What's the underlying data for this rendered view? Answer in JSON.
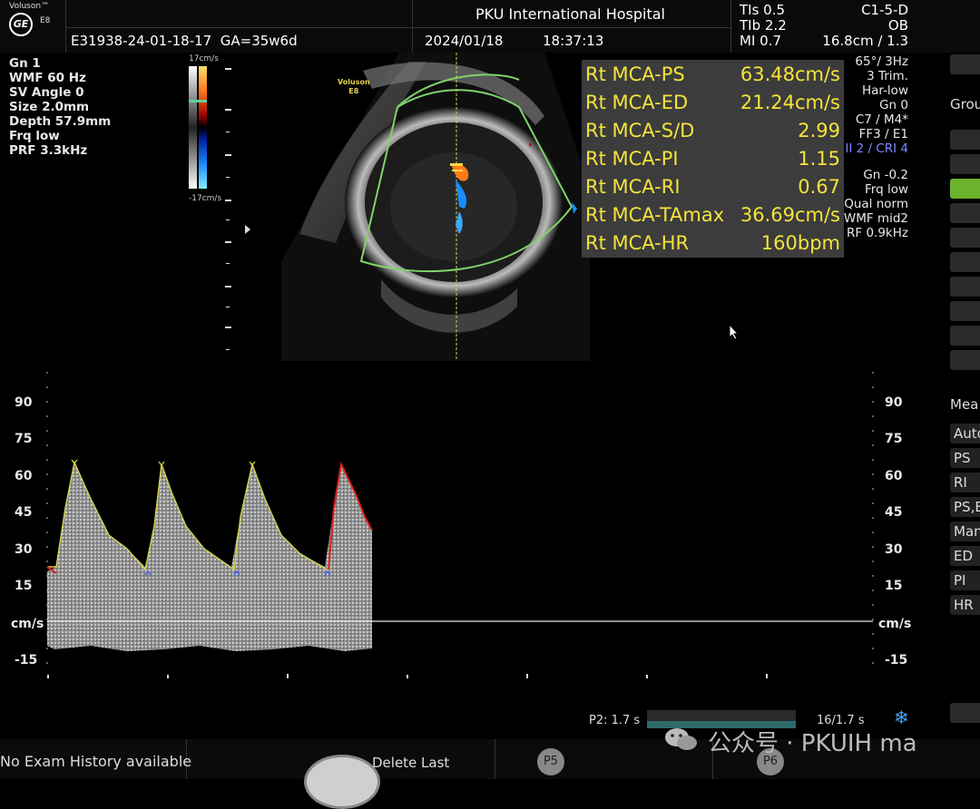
{
  "header": {
    "brand": "Voluson™",
    "logo": "GE",
    "model": "E8",
    "patient_id": "E31938-24-01-18-17",
    "ga": "GA=35w6d",
    "hospital": "PKU International Hospital",
    "date": "2024/01/18",
    "time": "18:37:13",
    "thermal": [
      "TIs  0.5",
      "TIb  2.2",
      "MI  0.7"
    ],
    "probe": [
      "C1-5-D",
      "OB",
      "16.8cm / 1.3"
    ]
  },
  "left_params": [
    "Gn  1",
    "WMF 60 Hz",
    "SV Angle  0",
    "Size  2.0mm",
    "Depth 57.9mm",
    "Frq low",
    "PRF  3.3kHz"
  ],
  "colorbar": {
    "top": "17cm/s",
    "bottom": "-17cm/s"
  },
  "image_logo": [
    "Voluson",
    "E8"
  ],
  "measurements": [
    {
      "label": "Rt MCA-PS",
      "value": "63.48cm/s"
    },
    {
      "label": "Rt MCA-ED",
      "value": "21.24cm/s"
    },
    {
      "label": "Rt MCA-S/D",
      "value": "2.99"
    },
    {
      "label": "Rt MCA-PI",
      "value": "1.15"
    },
    {
      "label": "Rt MCA-RI",
      "value": "0.67"
    },
    {
      "label": "Rt MCA-TAmax",
      "value": "36.69cm/s"
    },
    {
      "label": "Rt MCA-HR",
      "value": "160bpm"
    }
  ],
  "right_params_top": [
    "65°/  3Hz",
    "3 Trim.",
    "Har-low",
    "Gn  0",
    "C7 / M4*",
    "FF3 / E1",
    "II 2 / CRI 4"
  ],
  "right_params_bottom": [
    "Gn -0.2",
    "Frq low",
    "Qual norm",
    "WMF mid2",
    "RF  0.9kHz"
  ],
  "side_menu": {
    "group_label": "Grou",
    "meas_label": "Mea",
    "items": [
      "Auto",
      "PS",
      "RI",
      "PS,E",
      "Man",
      "ED",
      "PI",
      "HR"
    ]
  },
  "spectrum": {
    "ticks_left": [
      "90",
      "75",
      "60",
      "45",
      "30",
      "15",
      "cm/s",
      "-15"
    ],
    "ticks_right": [
      "90",
      "75",
      "60",
      "45",
      "30",
      "15",
      "cm/s",
      "-15"
    ]
  },
  "cine": {
    "p2_label": "P2:  1.7 s",
    "counter": "16/1.7 s",
    "progress": 1.0
  },
  "bottom": {
    "no_history": "No Exam History available",
    "delete_last": "Delete Last",
    "p5": "P5",
    "p6": "P6",
    "watermark": "公众号 · PKUIH ma"
  },
  "colors": {
    "measurement": "#f5e33a",
    "trace": "#d6d24a",
    "sector": "#7fd26a",
    "cri": "#7f85ff"
  }
}
